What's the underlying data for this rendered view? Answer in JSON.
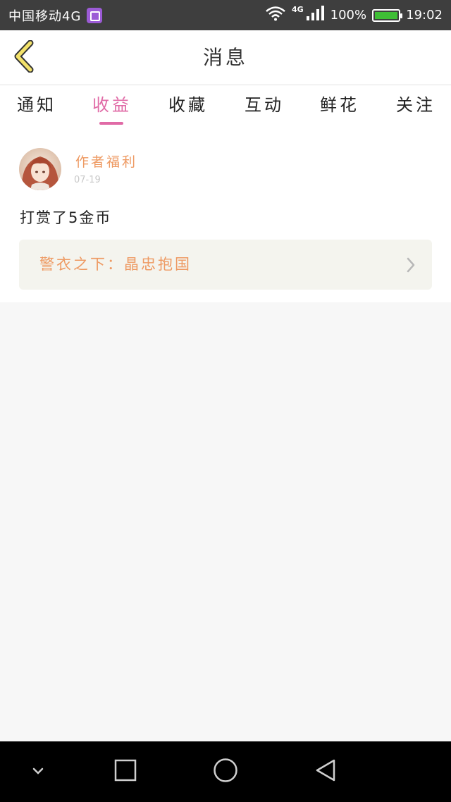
{
  "status_bar": {
    "carrier": "中国移动4G",
    "network_small": "4G",
    "battery_text": "100%",
    "time": "19:02",
    "battery_level": 1.0
  },
  "header": {
    "title": "消息"
  },
  "tabs": [
    {
      "label": "通知",
      "active": false
    },
    {
      "label": "收益",
      "active": true
    },
    {
      "label": "收藏",
      "active": false
    },
    {
      "label": "互动",
      "active": false
    },
    {
      "label": "鲜花",
      "active": false
    },
    {
      "label": "关注",
      "active": false
    }
  ],
  "message_card": {
    "sender": "作者福利",
    "date": "07-19",
    "text": "打赏了5金币",
    "link_text": "警衣之下：晶忠抱国"
  },
  "colors": {
    "accent_pink": "#e06aa6",
    "accent_orange": "#ee9a63",
    "back_arrow_yellow": "#f3e26a",
    "status_bar_bg": "#3e3e3e",
    "battery_green": "#3fbe36"
  },
  "icons": {
    "back": "chevron-left-icon",
    "link_chevron": "chevron-right-icon",
    "nav": [
      "chevron-down-icon",
      "square-icon",
      "circle-icon",
      "triangle-back-icon"
    ]
  }
}
